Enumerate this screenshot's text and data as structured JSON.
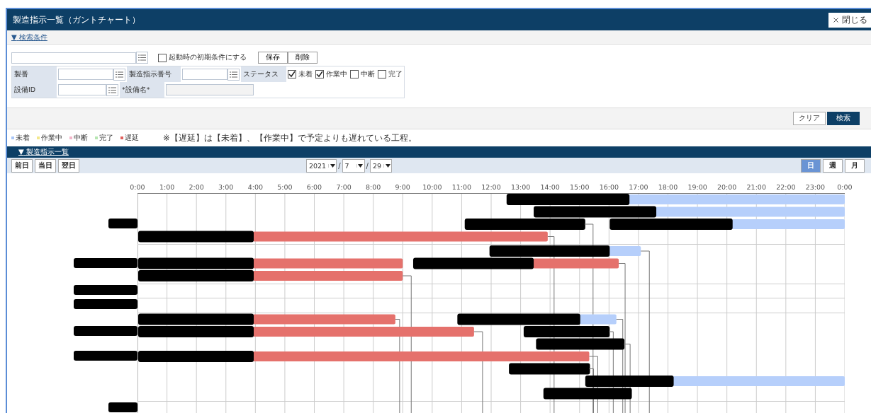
{
  "window": {
    "title": "製造指示一覧（ガントチャート）",
    "close": "閉じる"
  },
  "search_section": {
    "toggle": "▼",
    "title": "検索条件"
  },
  "preset": {
    "startup_checkbox": {
      "label": "起動時の初期条件にする",
      "checked": false
    },
    "buttons": [
      "保存",
      "削除"
    ]
  },
  "fields": [
    {
      "label": "製番"
    },
    {
      "label": "製造指示番号"
    },
    {
      "label": "設備ID"
    },
    {
      "label": "*設備名*"
    }
  ],
  "status": {
    "label": "ステータス",
    "options": [
      {
        "label": "未着",
        "checked": true
      },
      {
        "label": "作業中",
        "checked": true
      },
      {
        "label": "中断",
        "checked": false
      },
      {
        "label": "完了",
        "checked": false
      }
    ]
  },
  "action_buttons": [
    {
      "label": "クリア",
      "kind": "plain"
    },
    {
      "label": "検索",
      "kind": "primary"
    }
  ],
  "legend": [
    {
      "label": "未着",
      "color": "#a9c6f7"
    },
    {
      "label": "作業中",
      "color": "#f3e88c"
    },
    {
      "label": "中断",
      "color": "#f4b6ca"
    },
    {
      "label": "完了",
      "color": "#b6e6b1"
    },
    {
      "label": "遅延",
      "color": "#e0605d"
    }
  ],
  "legend_note": "※【遅延】は【未着】、【作業中】で予定よりも遅れている工程。",
  "list_section": {
    "toggle": "▼",
    "title": "製造指示一覧"
  },
  "day_buttons": [
    "前日",
    "当日",
    "翌日"
  ],
  "date": {
    "year": "2021",
    "month": "7",
    "day": "29",
    "separator": "/"
  },
  "view_tabs": [
    {
      "label": "日",
      "selected": true
    },
    {
      "label": "週",
      "selected": false
    },
    {
      "label": "月",
      "selected": false
    }
  ],
  "rows": [
    {
      "divider": false,
      "kind": "none"
    },
    {
      "divider": false,
      "kind": "none"
    },
    {
      "divider": false,
      "kind": "short"
    },
    {
      "divider": true,
      "kind": "none"
    },
    {
      "divider": false,
      "kind": "none"
    },
    {
      "divider": false,
      "kind": "long"
    },
    {
      "divider": true,
      "kind": "none"
    },
    {
      "divider": true,
      "kind": "long"
    },
    {
      "divider": true,
      "kind": "long"
    },
    {
      "divider": false,
      "kind": "none"
    },
    {
      "divider": false,
      "kind": "long"
    },
    {
      "divider": false,
      "kind": "none"
    },
    {
      "divider": false,
      "kind": "long"
    },
    {
      "divider": false,
      "kind": "none"
    },
    {
      "divider": false,
      "kind": "none"
    },
    {
      "divider": true,
      "kind": "none"
    },
    {
      "divider": false,
      "kind": "short"
    }
  ],
  "hours": [
    "0:00",
    "1:00",
    "2:00",
    "3:00",
    "4:00",
    "5:00",
    "6:00",
    "7:00",
    "8:00",
    "9:00",
    "10:00",
    "11:00",
    "12:00",
    "13:00",
    "14:00",
    "15:00",
    "16:00",
    "17:00",
    "18:00",
    "19:00",
    "20:00",
    "21:00",
    "22:00",
    "23:00",
    "0:00"
  ]
}
